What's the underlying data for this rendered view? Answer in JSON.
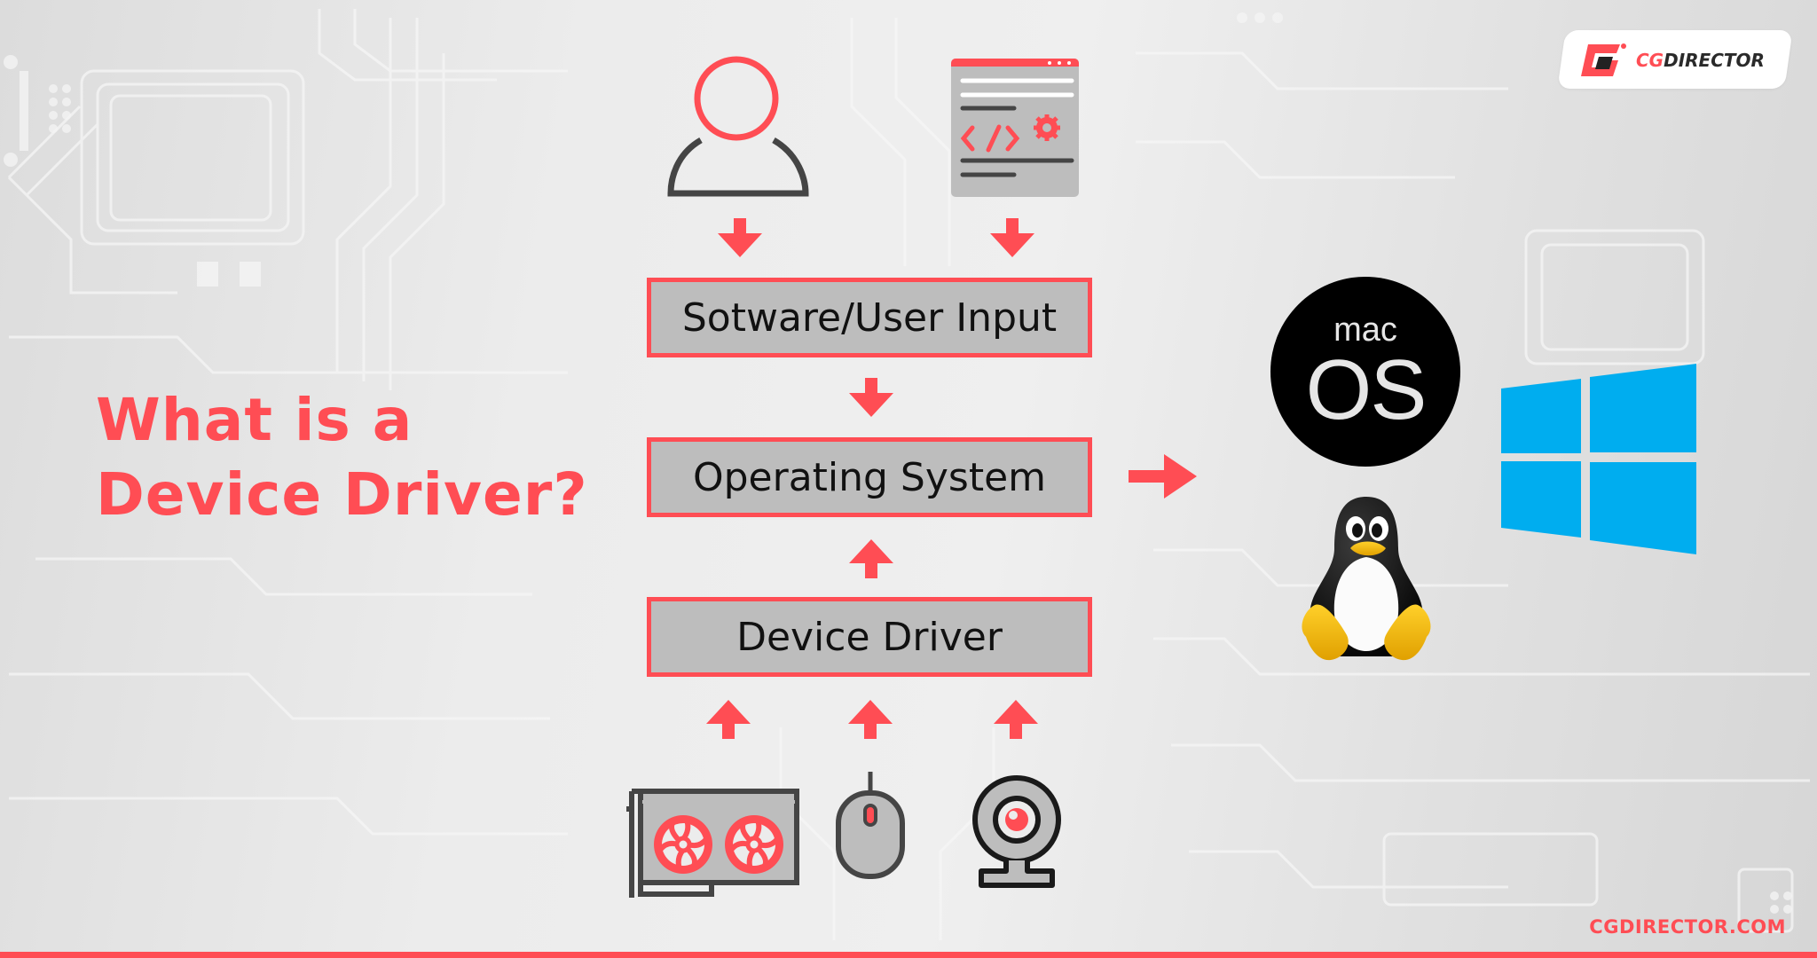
{
  "title": {
    "line1": "What is a",
    "line2": "Device Driver?"
  },
  "flow": {
    "boxes": [
      {
        "label": "Sotware/User Input"
      },
      {
        "label": "Operating System"
      },
      {
        "label": "Device Driver"
      }
    ],
    "inputs": [
      {
        "icon": "user-icon",
        "arrow": "down"
      },
      {
        "icon": "software-window-icon",
        "arrow": "down"
      }
    ],
    "devices": [
      {
        "icon": "graphics-card-icon",
        "arrow": "up"
      },
      {
        "icon": "mouse-icon",
        "arrow": "up"
      },
      {
        "icon": "webcam-icon",
        "arrow": "up"
      }
    ],
    "os_arrow": "right"
  },
  "operating_systems": [
    {
      "name": "macOS",
      "icon": "macos-logo",
      "line1": "mac",
      "line2": "OS"
    },
    {
      "name": "Linux",
      "icon": "tux-penguin-logo"
    },
    {
      "name": "Windows",
      "icon": "windows-logo"
    }
  ],
  "brand": {
    "logo_prefix": "CG",
    "logo_suffix": "DIRECTOR",
    "url": "CGDIRECTOR.COM"
  },
  "colors": {
    "accent": "#ff4d54",
    "box_fill": "#bdbdbd",
    "icon_dark": "#454545",
    "windows_blue": "#00adef",
    "tux_yellow": "#f5b800"
  }
}
